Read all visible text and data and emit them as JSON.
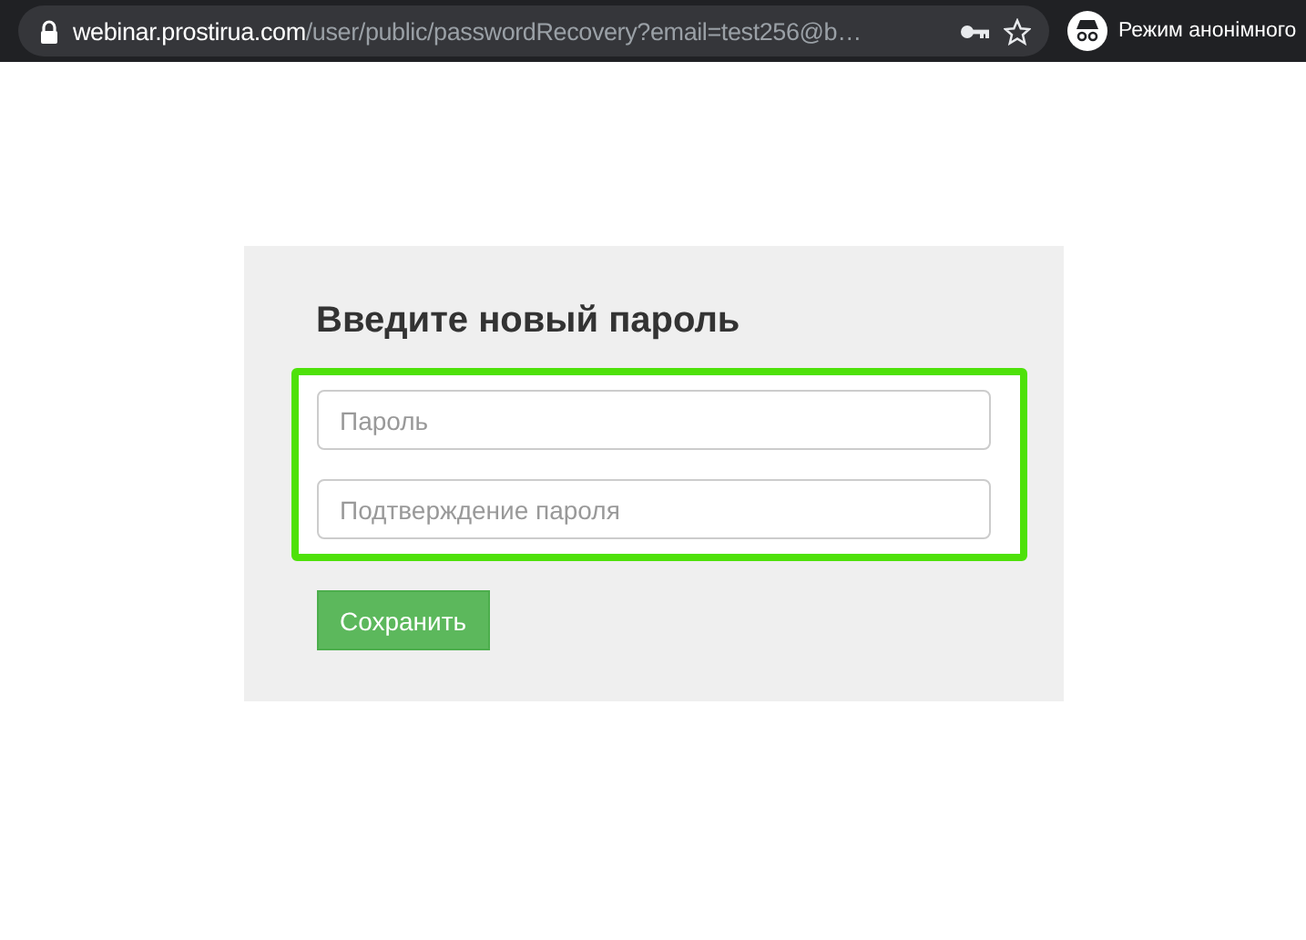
{
  "browser": {
    "url_host": "webinar.prostirua.com",
    "url_path": "/user/public/passwordRecovery?email=test256@b…",
    "incognito_label": "Режим анонімного"
  },
  "form": {
    "title": "Введите новый пароль",
    "fields": [
      {
        "placeholder": "Пароль"
      },
      {
        "placeholder": "Подтверждение пароля"
      }
    ],
    "submit": "Сохранить"
  }
}
